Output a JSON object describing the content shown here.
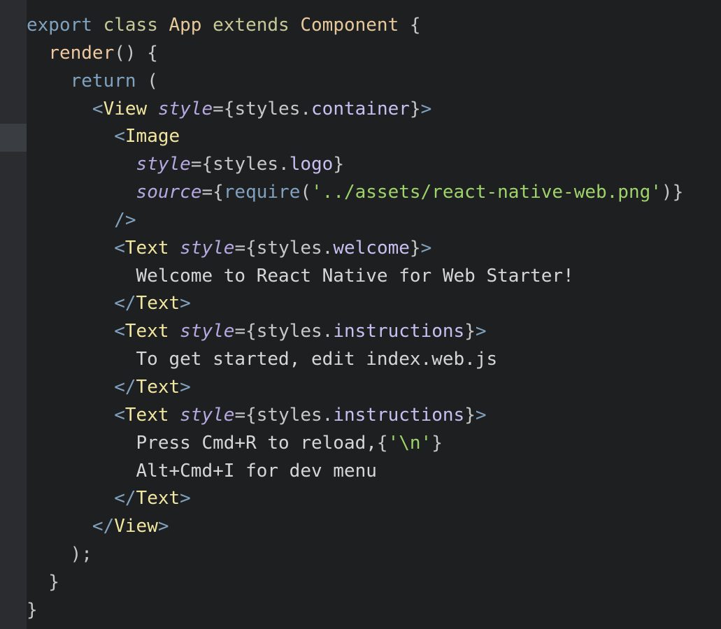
{
  "code_lines": [
    [
      {
        "t": "export",
        "c": "kw"
      },
      {
        "t": " class ",
        "c": "ext"
      },
      {
        "t": "App",
        "c": "cls"
      },
      {
        "t": " extends ",
        "c": "ext"
      },
      {
        "t": "Component",
        "c": "cls"
      },
      {
        "t": " {",
        "c": "punc"
      }
    ],
    [
      {
        "t": "  ",
        "c": "punc"
      },
      {
        "t": "render",
        "c": "fn"
      },
      {
        "t": "() {",
        "c": "punc"
      }
    ],
    [
      {
        "t": "    ",
        "c": "punc"
      },
      {
        "t": "return",
        "c": "kw"
      },
      {
        "t": " (",
        "c": "punc"
      }
    ],
    [
      {
        "t": "      ",
        "c": "punc"
      },
      {
        "t": "<",
        "c": "brk"
      },
      {
        "t": "View",
        "c": "tag"
      },
      {
        "t": " ",
        "c": "punc"
      },
      {
        "t": "style",
        "c": "attr"
      },
      {
        "t": "={styles.",
        "c": "punc"
      },
      {
        "t": "container",
        "c": "prop"
      },
      {
        "t": "}",
        "c": "punc"
      },
      {
        "t": ">",
        "c": "brk"
      }
    ],
    [
      {
        "t": "        ",
        "c": "punc"
      },
      {
        "t": "<",
        "c": "brk"
      },
      {
        "t": "Image",
        "c": "tag"
      }
    ],
    [
      {
        "t": "          ",
        "c": "punc"
      },
      {
        "t": "style",
        "c": "attr"
      },
      {
        "t": "={styles.",
        "c": "punc"
      },
      {
        "t": "logo",
        "c": "prop"
      },
      {
        "t": "}",
        "c": "punc"
      }
    ],
    [
      {
        "t": "          ",
        "c": "punc"
      },
      {
        "t": "source",
        "c": "attr"
      },
      {
        "t": "={",
        "c": "punc"
      },
      {
        "t": "require",
        "c": "kw"
      },
      {
        "t": "(",
        "c": "punc"
      },
      {
        "t": "'../assets/react-native-web.png'",
        "c": "str"
      },
      {
        "t": ")}",
        "c": "punc"
      }
    ],
    [
      {
        "t": "        ",
        "c": "punc"
      },
      {
        "t": "/>",
        "c": "brk"
      }
    ],
    [
      {
        "t": "        ",
        "c": "punc"
      },
      {
        "t": "<",
        "c": "brk"
      },
      {
        "t": "Text",
        "c": "tag"
      },
      {
        "t": " ",
        "c": "punc"
      },
      {
        "t": "style",
        "c": "attr"
      },
      {
        "t": "={styles.",
        "c": "punc"
      },
      {
        "t": "welcome",
        "c": "prop"
      },
      {
        "t": "}",
        "c": "punc"
      },
      {
        "t": ">",
        "c": "brk"
      }
    ],
    [
      {
        "t": "          Welcome to React Native for Web Starter!",
        "c": "txt"
      }
    ],
    [
      {
        "t": "        ",
        "c": "punc"
      },
      {
        "t": "</",
        "c": "brk"
      },
      {
        "t": "Text",
        "c": "tag"
      },
      {
        "t": ">",
        "c": "brk"
      }
    ],
    [
      {
        "t": "        ",
        "c": "punc"
      },
      {
        "t": "<",
        "c": "brk"
      },
      {
        "t": "Text",
        "c": "tag"
      },
      {
        "t": " ",
        "c": "punc"
      },
      {
        "t": "style",
        "c": "attr"
      },
      {
        "t": "={styles.",
        "c": "punc"
      },
      {
        "t": "instructions",
        "c": "prop"
      },
      {
        "t": "}",
        "c": "punc"
      },
      {
        "t": ">",
        "c": "brk"
      }
    ],
    [
      {
        "t": "          To get started, edit index.web.js",
        "c": "txt"
      }
    ],
    [
      {
        "t": "        ",
        "c": "punc"
      },
      {
        "t": "</",
        "c": "brk"
      },
      {
        "t": "Text",
        "c": "tag"
      },
      {
        "t": ">",
        "c": "brk"
      }
    ],
    [
      {
        "t": "        ",
        "c": "punc"
      },
      {
        "t": "<",
        "c": "brk"
      },
      {
        "t": "Text",
        "c": "tag"
      },
      {
        "t": " ",
        "c": "punc"
      },
      {
        "t": "style",
        "c": "attr"
      },
      {
        "t": "={styles.",
        "c": "punc"
      },
      {
        "t": "instructions",
        "c": "prop"
      },
      {
        "t": "}",
        "c": "punc"
      },
      {
        "t": ">",
        "c": "brk"
      }
    ],
    [
      {
        "t": "          Press Cmd+R to reload,",
        "c": "txt"
      },
      {
        "t": "{",
        "c": "punc"
      },
      {
        "t": "'\\n'",
        "c": "str"
      },
      {
        "t": "}",
        "c": "punc"
      }
    ],
    [
      {
        "t": "          Alt+Cmd+I for dev menu",
        "c": "txt"
      }
    ],
    [
      {
        "t": "        ",
        "c": "punc"
      },
      {
        "t": "</",
        "c": "brk"
      },
      {
        "t": "Text",
        "c": "tag"
      },
      {
        "t": ">",
        "c": "brk"
      }
    ],
    [
      {
        "t": "      ",
        "c": "punc"
      },
      {
        "t": "</",
        "c": "brk"
      },
      {
        "t": "View",
        "c": "tag"
      },
      {
        "t": ">",
        "c": "brk"
      }
    ],
    [
      {
        "t": "    );",
        "c": "punc"
      }
    ],
    [
      {
        "t": "  }",
        "c": "punc"
      }
    ],
    [
      {
        "t": "}",
        "c": "punc"
      }
    ]
  ],
  "theme": {
    "background": "#1e1f21",
    "gutter": "#2a2c2f",
    "active_line_gutter": "#3a3d41"
  }
}
